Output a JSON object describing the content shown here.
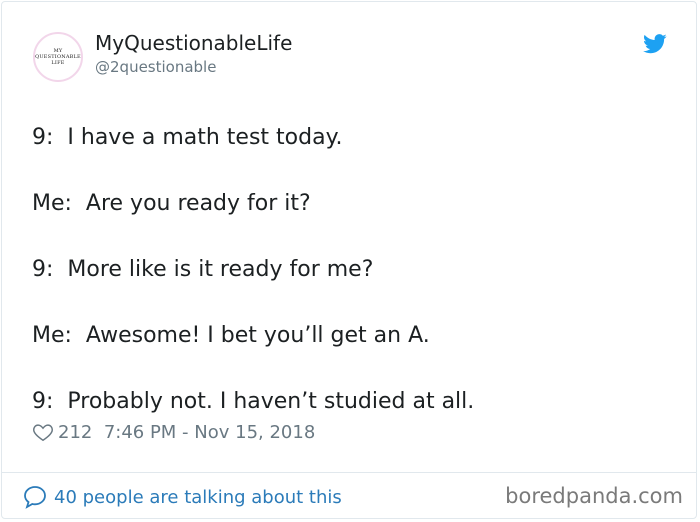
{
  "author": {
    "display_name": "MyQuestionableLife",
    "handle": "@2questionable",
    "avatar_text": [
      "MY",
      "QUESTIONABLE",
      "LIFE"
    ]
  },
  "tweet": {
    "lines": [
      "9:  I have a math test today.",
      "Me:  Are you ready for it?",
      "9:  More like is it ready for me?",
      "Me:  Awesome! I bet you’ll get an A.",
      "9:  Probably not. I haven’t studied at all."
    ],
    "likes": "212",
    "timestamp": "7:46 PM - Nov 15, 2018"
  },
  "footer": {
    "talking": "40 people are talking about this",
    "watermark": "boredpanda.com"
  },
  "icons": [
    "twitter-bird-icon",
    "heart-icon",
    "speech-bubble-icon"
  ],
  "colors": {
    "accent": "#1da1f2",
    "link": "#2b7bb9",
    "muted": "#697882"
  }
}
